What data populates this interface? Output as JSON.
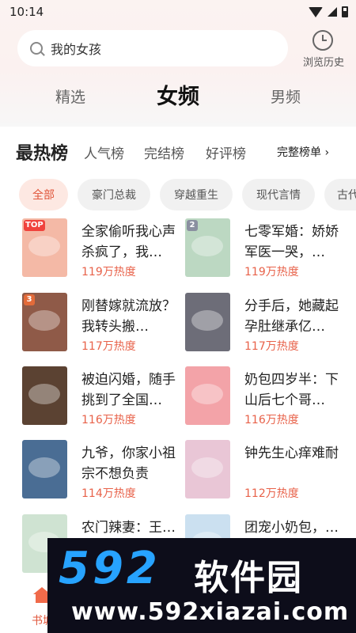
{
  "status": {
    "time": "10:14"
  },
  "search": {
    "query": "我的女孩"
  },
  "history": {
    "label": "浏览历史"
  },
  "top_tabs": [
    "精选",
    "女频",
    "男频"
  ],
  "rank": {
    "title": "最热榜",
    "tabs": [
      "人气榜",
      "完结榜",
      "好评榜"
    ],
    "full_list": "完整榜单 ›"
  },
  "chips": [
    "全部",
    "豪门总裁",
    "穿越重生",
    "现代言情",
    "古代"
  ],
  "books": [
    {
      "title": "全家偷听我心声杀疯了，我…",
      "heat": "119万热度",
      "badge": "TOP",
      "badge_color": "#f0423c",
      "cover_color": "#f4b9a6"
    },
    {
      "title": "七零军婚：娇娇军医一哭，…",
      "heat": "119万热度",
      "badge": "2",
      "badge_color": "#8a8fa0",
      "cover_color": "#bcd8c2"
    },
    {
      "title": "刚替嫁就流放？我转头搬…",
      "heat": "117万热度",
      "badge": "3",
      "badge_color": "#e36b3a",
      "cover_color": "#8f5a48"
    },
    {
      "title": "分手后，她藏起孕肚继承亿…",
      "heat": "117万热度",
      "badge": "",
      "badge_color": "#cccccc",
      "cover_color": "#6d6d78"
    },
    {
      "title": "被迫闪婚，随手挑到了全国…",
      "heat": "116万热度",
      "badge": "",
      "badge_color": "#cccccc",
      "cover_color": "#5b4232"
    },
    {
      "title": "奶包四岁半：下山后七个哥…",
      "heat": "116万热度",
      "badge": "",
      "badge_color": "#cccccc",
      "cover_color": "#f3a3a8"
    },
    {
      "title": "九爷，你家小祖宗不想负责",
      "heat": "114万热度",
      "badge": "",
      "badge_color": "#cccccc",
      "cover_color": "#4a6d94"
    },
    {
      "title": "钟先生心痒难耐",
      "heat": "112万热度",
      "badge": "",
      "badge_color": "#cccccc",
      "cover_color": "#e9c6d6"
    },
    {
      "title": "农门辣妻：王…",
      "heat": "",
      "badge": "",
      "badge_color": "#cccccc",
      "cover_color": "#cfe3d2"
    },
    {
      "title": "团宠小奶包，…",
      "heat": "",
      "badge": "",
      "badge_color": "#cccccc",
      "cover_color": "#cbe0f0"
    }
  ],
  "bottom_nav": {
    "home_label": "书城"
  },
  "watermark": {
    "logo": "592",
    "name": "软件园",
    "url": "www.592xiazai.com"
  }
}
